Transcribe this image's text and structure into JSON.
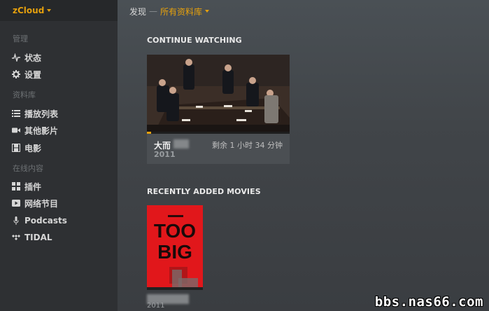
{
  "sidebar": {
    "brand": "zCloud",
    "sections": [
      {
        "label": "管理"
      },
      {
        "label": "资料库"
      },
      {
        "label": "在线内容"
      }
    ],
    "items": [
      {
        "label": "状态",
        "icon": "activity-icon"
      },
      {
        "label": "设置",
        "icon": "gear-icon"
      },
      {
        "label": "播放列表",
        "icon": "list-icon"
      },
      {
        "label": "其他影片",
        "icon": "video-camera-icon"
      },
      {
        "label": "电影",
        "icon": "film-icon"
      },
      {
        "label": "插件",
        "icon": "grid-icon"
      },
      {
        "label": "网络节目",
        "icon": "play-icon"
      },
      {
        "label": "Podcasts",
        "icon": "microphone-icon"
      },
      {
        "label": "TIDAL",
        "icon": "tidal-icon"
      }
    ]
  },
  "header": {
    "root": "发现",
    "separator": "—",
    "library": "所有资料库"
  },
  "continue_watching": {
    "title": "CONTINUE WATCHING",
    "item": {
      "title": "大而",
      "year": "2011",
      "remaining": "剩余 1 小时 34 分钟",
      "progress": 0.03
    }
  },
  "recently_added": {
    "title": "RECENTLY ADDED MOVIES",
    "poster_lines": [
      "TOO",
      "BIG"
    ],
    "year": "2011"
  },
  "watermark": "bbs.nas66.com",
  "colors": {
    "accent": "#e5a00d",
    "sidebar": "#2e3033",
    "poster_red": "#e1171b"
  }
}
